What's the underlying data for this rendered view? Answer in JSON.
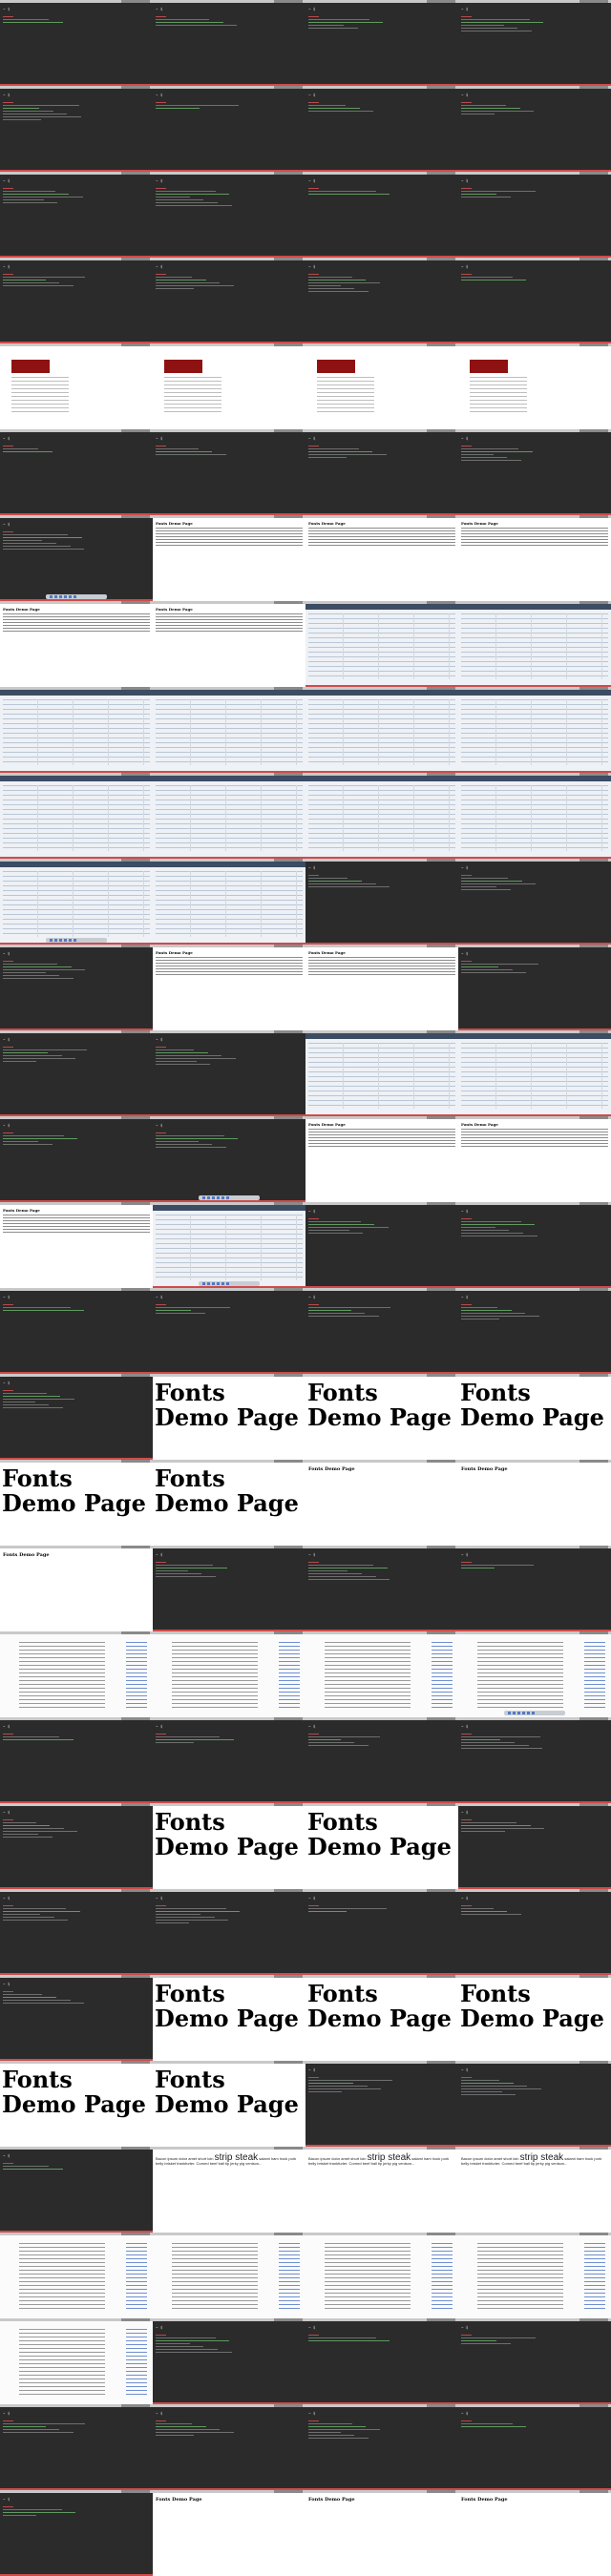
{
  "fonts_demo_title": "Fonts Demo Page",
  "terminal_text": "~ $",
  "article": {
    "lead": "Bacon ipsum dolor amet short loin",
    "big_word": "strip steak",
    "rest": "salami ham hock pork belly brisket frankfurter. Corned beef ball tip jerky pig venison..."
  },
  "tiles": [
    "terminal",
    "terminal",
    "terminal",
    "terminal",
    "terminal",
    "terminal",
    "terminal",
    "terminal",
    "terminal",
    "terminal",
    "terminal",
    "terminal",
    "terminal",
    "terminal",
    "terminal",
    "terminal",
    "web",
    "web",
    "web",
    "web",
    "terminal",
    "terminal",
    "terminal",
    "terminal",
    "terminal-dock",
    "text",
    "text",
    "text",
    "text",
    "text",
    "dash",
    "dash",
    "dash",
    "dash",
    "dash",
    "dash",
    "dash",
    "dash",
    "dash",
    "dash",
    "dash-dock",
    "dash",
    "terminal",
    "terminal",
    "terminal",
    "text",
    "text",
    "terminal",
    "terminal",
    "terminal",
    "dash",
    "dash",
    "terminal",
    "terminal-dock",
    "text",
    "text",
    "text",
    "dash-dock",
    "terminal",
    "terminal",
    "terminal",
    "terminal",
    "terminal",
    "terminal",
    "terminal",
    "fonts-big",
    "fonts-big",
    "fonts-big",
    "fonts-big",
    "fonts-big",
    "fonts-small",
    "fonts-small",
    "fonts-small",
    "terminal",
    "terminal",
    "terminal",
    "docs",
    "docs",
    "docs",
    "docs-dock",
    "terminal",
    "terminal",
    "terminal",
    "terminal",
    "terminal",
    "fonts-big",
    "fonts-big",
    "terminal",
    "terminal",
    "terminal",
    "terminal",
    "terminal",
    "terminal",
    "fonts-big",
    "fonts-big",
    "fonts-big",
    "fonts-big",
    "fonts-big",
    "terminal",
    "terminal",
    "terminal",
    "article",
    "article",
    "article",
    "docs",
    "docs",
    "docs",
    "docs",
    "docs",
    "terminal",
    "terminal",
    "terminal",
    "terminal",
    "terminal",
    "terminal",
    "terminal",
    "terminal",
    "fonts-small",
    "fonts-small",
    "fonts-small"
  ]
}
